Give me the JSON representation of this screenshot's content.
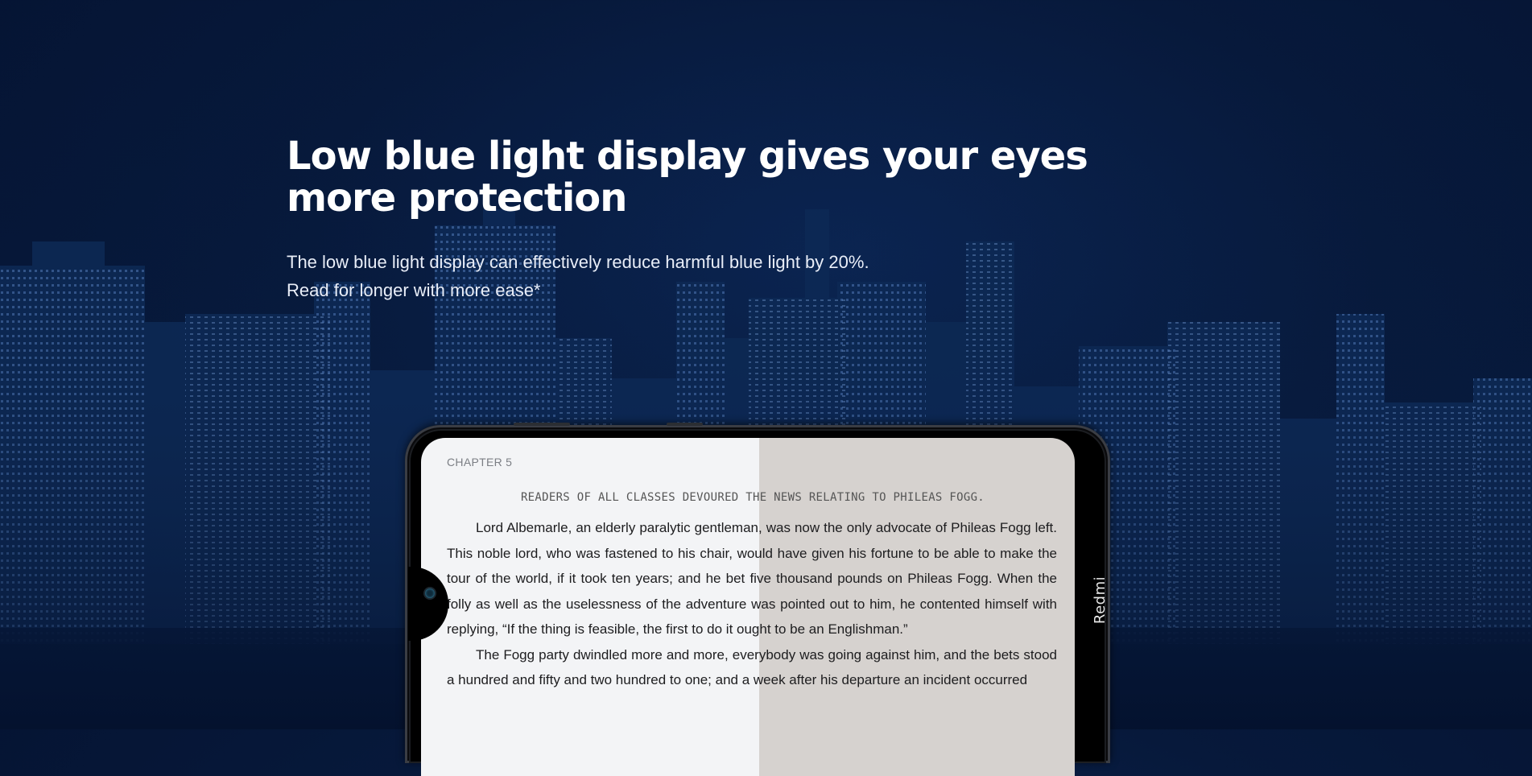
{
  "hero": {
    "title": "Low blue light display gives your eyes more protection",
    "subtitle_line1": "The low blue light display can effectively reduce harmful blue light by 20%.",
    "subtitle_line2": "Read for longer with more ease*"
  },
  "phone": {
    "brand": "Redmi",
    "screen_split_fraction": 0.517,
    "reader": {
      "chapter": "CHAPTER 5",
      "headline": "READERS OF ALL CLASSES DEVOURED THE NEWS RELATING TO PHILEAS FOGG.",
      "paragraphs": [
        "Lord Albemarle, an elderly paralytic gentleman, was now the only advocate of Phileas Fogg left. This noble lord, who was fastened to his chair, would have given his fortune to be able to make the tour of the world, if it took ten years; and he bet five thousand pounds on Phileas Fogg. When the folly as well as the uselessness of the adventure was pointed out to him, he contented himself with replying, “If the thing is feasible, the first to do it ought to be an Englishman.”",
        "The Fogg party dwindled more and more, everybody was going against him, and the bets stood a hundred and fifty and two hundred to one; and a week after his departure an incident occurred"
      ]
    }
  },
  "colors": {
    "background": "#07193b",
    "screen_left": "#f3f4f6",
    "screen_right": "#d6d2cf",
    "title_text": "#ffffff"
  }
}
